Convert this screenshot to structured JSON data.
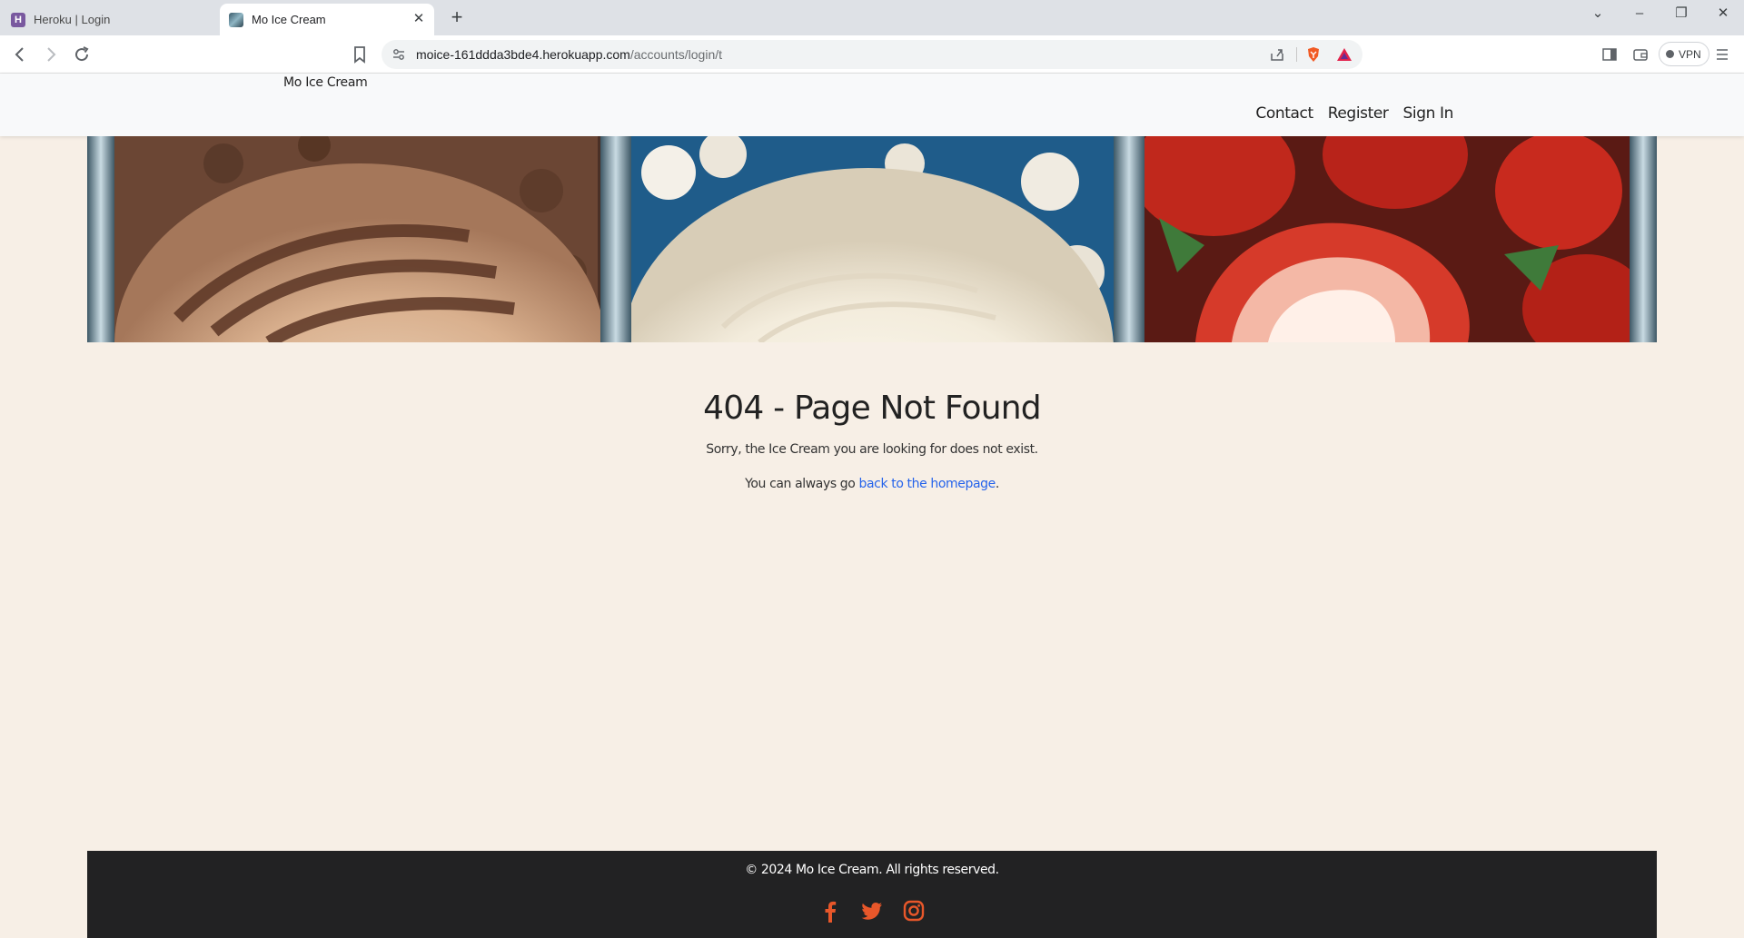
{
  "browser": {
    "tabs": [
      {
        "title": "Heroku | Login",
        "favicon": "heroku-icon",
        "active": false
      },
      {
        "title": "Mo Ice Cream",
        "favicon": "ice-cream-favicon",
        "active": true
      }
    ],
    "url_host": "moice-161ddda3bde4.herokuapp.com",
    "url_path": "/accounts/login/t",
    "vpn_label": "VPN"
  },
  "site": {
    "brand": "Mo Ice Cream",
    "nav": [
      "Contact",
      "Register",
      "Sign In"
    ]
  },
  "error": {
    "heading": "404 - Page Not Found",
    "message": "Sorry, the Ice Cream you are looking for does not exist.",
    "homepage_prefix": "You can always go ",
    "homepage_link": "back to the homepage",
    "homepage_suffix": "."
  },
  "footer": {
    "copyright": "© 2024 Mo Ice Cream. All rights reserved.",
    "social": [
      "facebook-icon",
      "twitter-icon",
      "instagram-icon"
    ],
    "accent_color": "#e8572a"
  }
}
